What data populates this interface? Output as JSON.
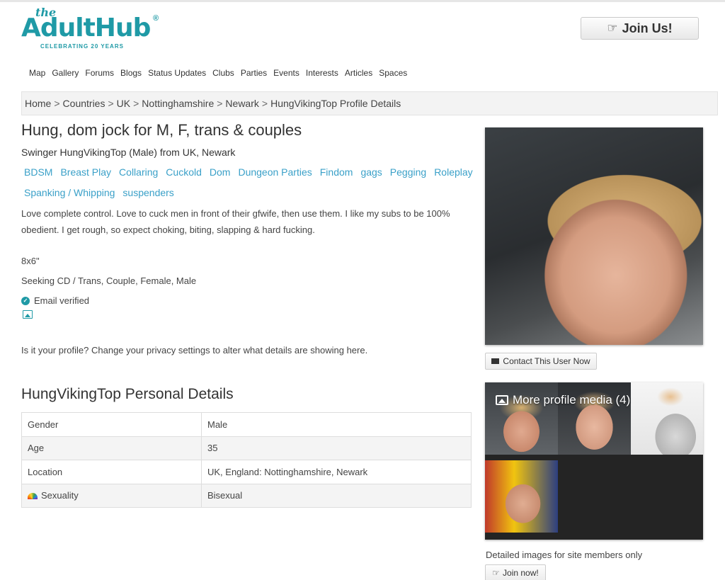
{
  "header": {
    "logo_the": "the",
    "logo_brand": "AdultHub",
    "logo_reg": "®",
    "logo_tagline": "CELEBRATING 20 YEARS",
    "join_us_label": "Join Us!"
  },
  "nav": {
    "items": [
      "Map",
      "Gallery",
      "Forums",
      "Blogs",
      "Status Updates",
      "Clubs",
      "Parties",
      "Events",
      "Interests",
      "Articles",
      "Spaces"
    ]
  },
  "breadcrumb": {
    "items": [
      "Home",
      "Countries",
      "UK",
      "Nottinghamshire",
      "Newark",
      "HungVikingTop Profile Details"
    ],
    "separator": ">"
  },
  "profile": {
    "headline": "Hung, dom jock for M, F, trans & couples",
    "subtitle": "Swinger HungVikingTop (Male) from UK, Newark",
    "interests": [
      "BDSM",
      "Breast Play",
      "Collaring",
      "Cuckold",
      "Dom",
      "Dungeon Parties",
      "Findom",
      "gags",
      "Pegging",
      "Roleplay",
      "Spanking / Whipping",
      "suspenders"
    ],
    "description": "Love complete control. Love to cuck men in front of their gfwife, then use them. I like my subs to be 100% obedient. I get rough, so expect choking, biting, slapping & hard fucking.",
    "size": "8x6\"",
    "seeking": "Seeking CD / Trans, Couple, Female, Male",
    "email_verified": "Email verified",
    "privacy_note": "Is it your profile? Change your privacy settings to alter what details are showing here."
  },
  "details": {
    "title": "HungVikingTop Personal Details",
    "rows": [
      {
        "label": "Gender",
        "value": "Male"
      },
      {
        "label": "Age",
        "value": "35"
      },
      {
        "label": "Location",
        "value": "UK, England: Nottinghamshire, Newark"
      },
      {
        "label": "Sexuality",
        "value": "Bisexual"
      }
    ]
  },
  "sidebar": {
    "contact_label": "Contact This User Now",
    "media_title": "More profile media (4)",
    "members_only": "Detailed images for site members only",
    "join_now_label": "Join now!"
  },
  "icons": {
    "join": "hand-pointer-icon",
    "verified": "check-circle-icon",
    "image": "image-icon",
    "contact": "envelope-icon",
    "sexuality": "rainbow-icon"
  },
  "colors": {
    "brand": "#1f9aa6",
    "link": "#3aa0c8"
  }
}
